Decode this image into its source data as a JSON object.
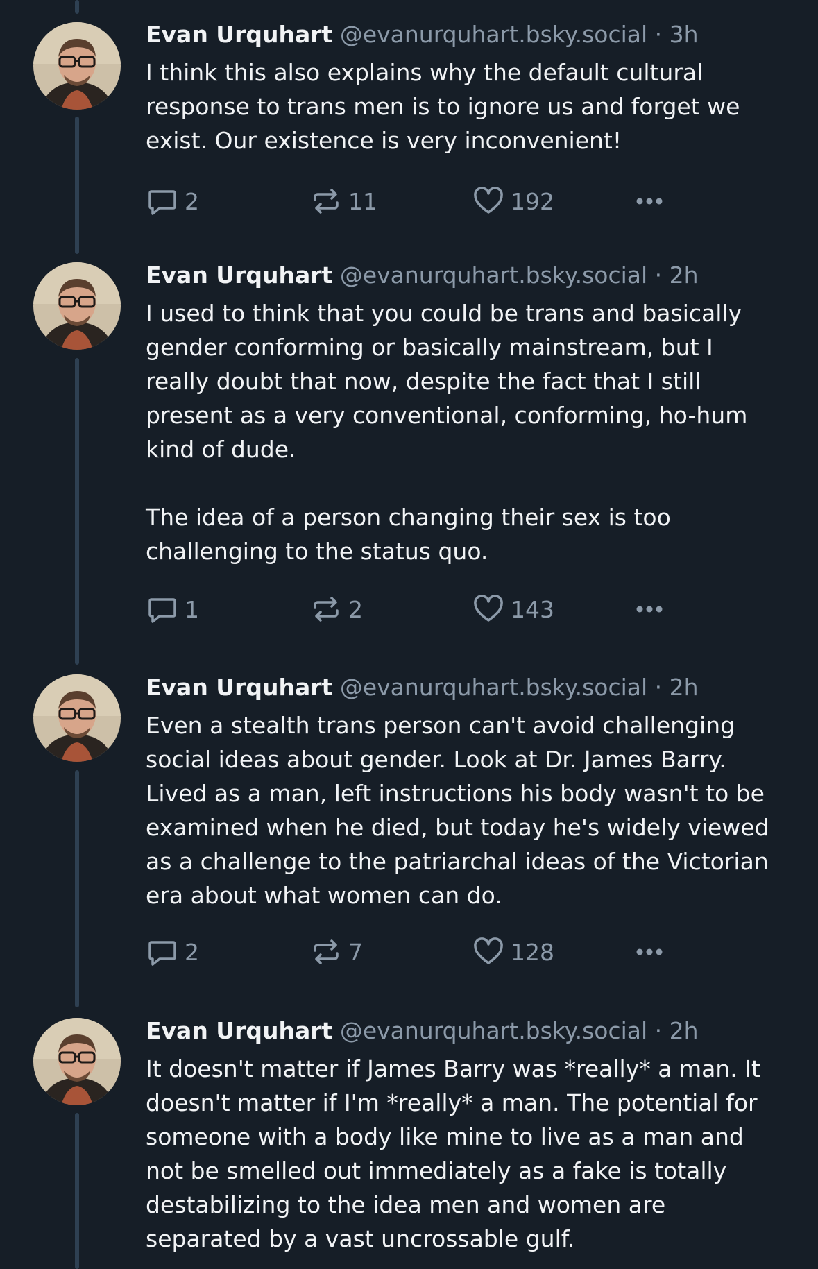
{
  "posts": [
    {
      "author_name": "Evan Urquhart",
      "author_handle": "@evanurquhart.bsky.social",
      "separator": "·",
      "time": "3h",
      "text": "I think this also explains why the default cultural response to trans men is to ignore us and forget we exist. Our existence is very inconvenient!",
      "replies": "2",
      "reposts": "11",
      "likes": "192"
    },
    {
      "author_name": "Evan Urquhart",
      "author_handle": "@evanurquhart.bsky.social",
      "separator": "·",
      "time": "2h",
      "text": "I used to think that you could be trans and basically gender conforming or basically mainstream, but I really doubt that now, despite the fact that I still present as a very conventional, conforming, ho-hum kind of dude.\n\nThe idea of a person changing their sex is too challenging to the status quo.",
      "replies": "1",
      "reposts": "2",
      "likes": "143"
    },
    {
      "author_name": "Evan Urquhart",
      "author_handle": "@evanurquhart.bsky.social",
      "separator": "·",
      "time": "2h",
      "text": "Even a stealth trans person can't avoid challenging social ideas about gender. Look at Dr. James Barry. Lived as a man, left instructions his body wasn't to be examined when he died, but today he's widely viewed as a challenge to the patriarchal ideas of the Victorian era about what women can do.",
      "replies": "2",
      "reposts": "7",
      "likes": "128"
    },
    {
      "author_name": "Evan Urquhart",
      "author_handle": "@evanurquhart.bsky.social",
      "separator": "·",
      "time": "2h",
      "text": "It doesn't matter if James Barry was *really* a man. It doesn't matter if I'm *really* a man. The potential for someone with a body like mine to live as a man and not be smelled out immediately as a fake is totally destabilizing to the idea men and women are separated by a vast uncrossable gulf."
    }
  ],
  "icons": {
    "reply": "reply-bubble-icon",
    "repost": "repost-arrows-icon",
    "like": "heart-icon",
    "more": "ellipsis-icon"
  },
  "colors": {
    "background": "#161e27",
    "text": "#f1f3f5",
    "muted": "#8c9aa9",
    "thread_line": "#2e4052"
  }
}
